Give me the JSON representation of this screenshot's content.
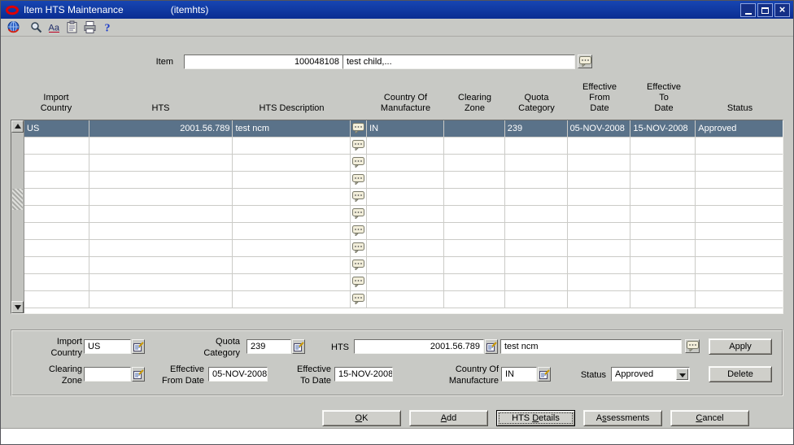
{
  "window": {
    "title": "Item HTS Maintenance",
    "subtitle": "(itemhts)"
  },
  "toolbar": {
    "icons": [
      "menu-globe-icon",
      "find-icon",
      "edit-icon",
      "clipboard-icon",
      "print-icon",
      "help-icon"
    ]
  },
  "icons": {
    "comment": "comment-icon",
    "lov": "list-of-values-icon"
  },
  "item": {
    "label": "Item",
    "number": "100048108",
    "description": "test child,..."
  },
  "table": {
    "headers": [
      "Import\nCountry",
      "HTS",
      "HTS Description",
      "Country Of\nManufacture",
      "Clearing\nZone",
      "Quota\nCategory",
      "Effective\nFrom\nDate",
      "Effective\nTo\nDate",
      "Status"
    ],
    "rows": [
      {
        "import_country": "US",
        "hts": "2001.56.789",
        "hts_description": "test ncm",
        "country_of_manufacture": "IN",
        "clearing_zone": "",
        "quota_category": "239",
        "effective_from": "05-NOV-2008",
        "effective_to": "15-NOV-2008",
        "status": "Approved"
      }
    ],
    "empty_rows": 10
  },
  "form": {
    "import_country_label": "Import\nCountry",
    "import_country": "US",
    "quota_category_label": "Quota\nCategory",
    "quota_category": "239",
    "hts_label": "HTS",
    "hts": "2001.56.789",
    "hts_description": "test ncm",
    "clearing_zone_label": "Clearing\nZone",
    "clearing_zone": "",
    "effective_from_label": "Effective\nFrom Date",
    "effective_from": "05-NOV-2008",
    "effective_to_label": "Effective\nTo Date",
    "effective_to": "15-NOV-2008",
    "country_of_manufacture_label": "Country Of\nManufacture",
    "country_of_manufacture": "IN",
    "status_label": "Status",
    "status": "Approved",
    "apply_label": "Apply",
    "delete_label": "Delete"
  },
  "buttons": {
    "ok": {
      "pre": "",
      "key": "O",
      "post": "K"
    },
    "add": {
      "pre": "",
      "key": "A",
      "post": "dd"
    },
    "hts_details": {
      "pre": "HTS ",
      "key": "D",
      "post": "etails"
    },
    "assessments": {
      "pre": "A",
      "key": "s",
      "post": "sessments"
    },
    "cancel": {
      "pre": "",
      "key": "C",
      "post": "ancel"
    }
  },
  "colors": {
    "titlebar": "#0e37a0",
    "selected_row": "#5a7289",
    "background": "#c8c9c5",
    "oracle_red": "#e00000"
  }
}
